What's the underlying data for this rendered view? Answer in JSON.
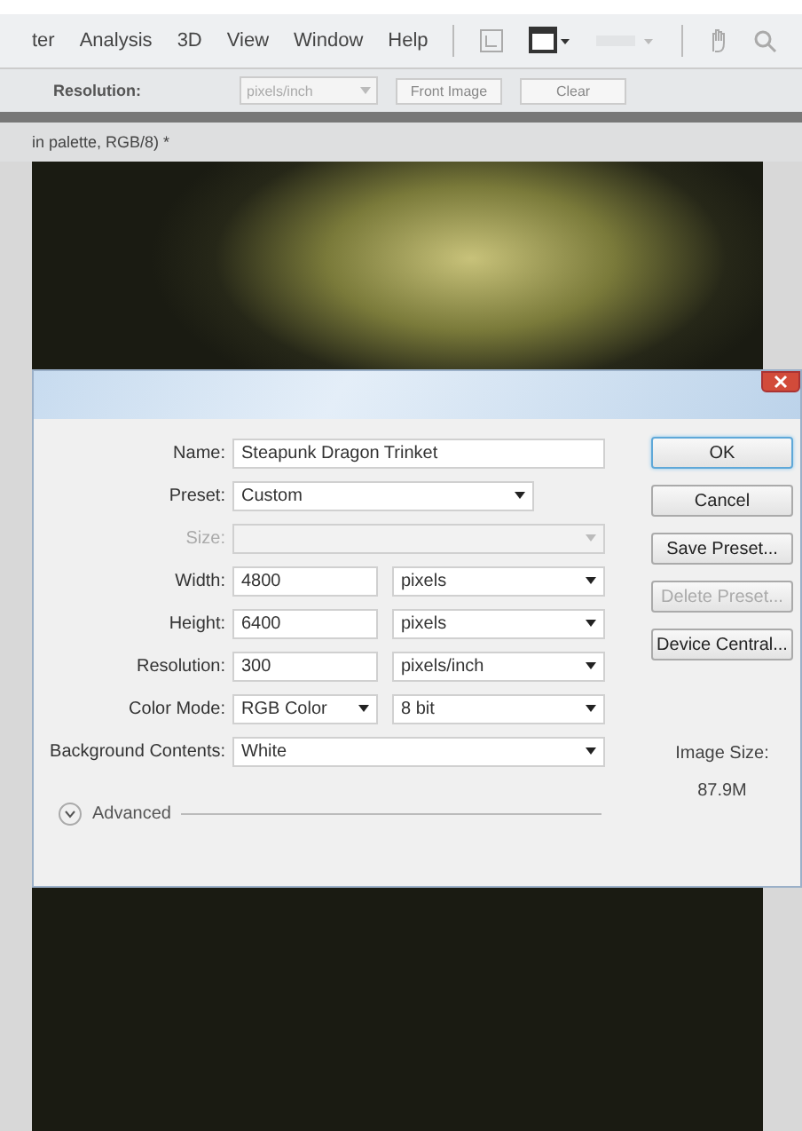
{
  "menu": [
    {
      "label": "ter"
    },
    {
      "label": "Analysis"
    },
    {
      "label": "3D"
    },
    {
      "label": "View"
    },
    {
      "label": "Window"
    },
    {
      "label": "Help"
    }
  ],
  "options_bar": {
    "label": "Resolution:",
    "unit": "pixels/inch",
    "buttons": [
      "Front Image",
      "Clear"
    ]
  },
  "document_tab": {
    "title": "in palette, RGB/8) *"
  },
  "dialog": {
    "fields": [
      {
        "kind": "text",
        "label": "Name:",
        "value": "Steapunk Dragon Trinket"
      },
      {
        "kind": "select",
        "label": "Preset:",
        "value": "Custom",
        "disabled": false
      },
      {
        "kind": "select",
        "label": "Size:",
        "disabled": true
      },
      {
        "kind": "pair",
        "label": "Width:",
        "value": "4800",
        "unit": "pixels"
      },
      {
        "kind": "pair",
        "label": "Height:",
        "value": "6400",
        "unit": "pixels"
      },
      {
        "kind": "pair",
        "label": "Resolution:",
        "value": "300",
        "unit": "pixels/inch"
      },
      {
        "kind": "selectpair",
        "label": "Color Mode:",
        "value": "RGB Color",
        "unit": "8 bit"
      },
      {
        "kind": "select",
        "label": "Background Contents:",
        "value": "White",
        "disabled": false
      }
    ],
    "advanced": {
      "label": "Advanced",
      "expanded": false
    },
    "buttons": [
      {
        "label": "OK",
        "default": true,
        "disabled": false
      },
      {
        "label": "Cancel",
        "default": false,
        "disabled": false
      },
      {
        "label": "Save Preset...",
        "default": false,
        "disabled": false
      },
      {
        "label": "Delete Preset...",
        "default": false,
        "disabled": true
      },
      {
        "label": "Device Central...",
        "default": false,
        "disabled": false
      }
    ],
    "image_size": {
      "label": "Image Size:",
      "value": "87.9M"
    }
  }
}
